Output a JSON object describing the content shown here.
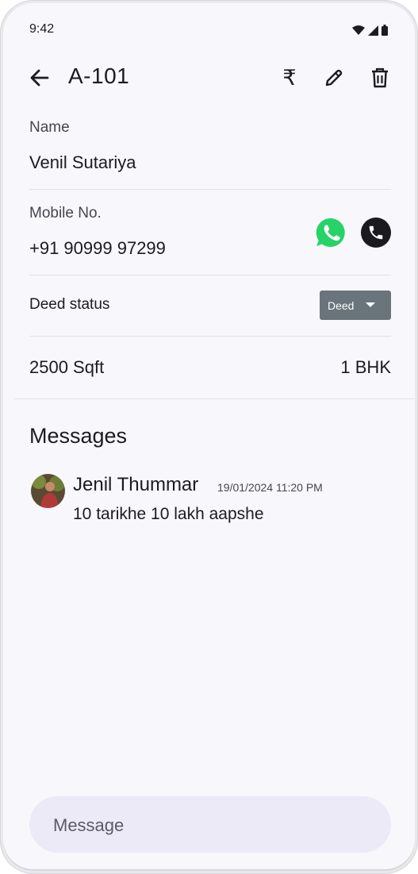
{
  "status_bar": {
    "time": "9:42",
    "icons": [
      "wifi-icon",
      "cellular-icon",
      "battery-icon"
    ]
  },
  "app_bar": {
    "title": "A-101",
    "back_icon": "arrow-left-icon",
    "actions": [
      {
        "name": "rupee",
        "glyph": "₹"
      },
      {
        "name": "edit",
        "icon": "pencil-icon"
      },
      {
        "name": "delete",
        "icon": "trash-icon"
      }
    ]
  },
  "details": {
    "name_label": "Name",
    "name_value": "Venil Sutariya",
    "mobile_label": "Mobile No.",
    "mobile_value": "+91 90999 97299",
    "deed_label": "Deed status",
    "deed_selected": "Deed",
    "area": "2500 Sqft",
    "type": "1 BHK"
  },
  "messages": {
    "title": "Messages",
    "items": [
      {
        "sender": "Jenil Thummar",
        "timestamp": "19/01/2024 11:20 PM",
        "text": "10 tarikhe 10 lakh aapshe"
      }
    ]
  },
  "composer": {
    "placeholder": "Message"
  },
  "colors": {
    "background": "#f8f7fc",
    "whatsapp": "#25d366",
    "call_button": "#1a1a1f",
    "select_bg": "#6a747b",
    "composer_bg": "#eceaf6"
  }
}
